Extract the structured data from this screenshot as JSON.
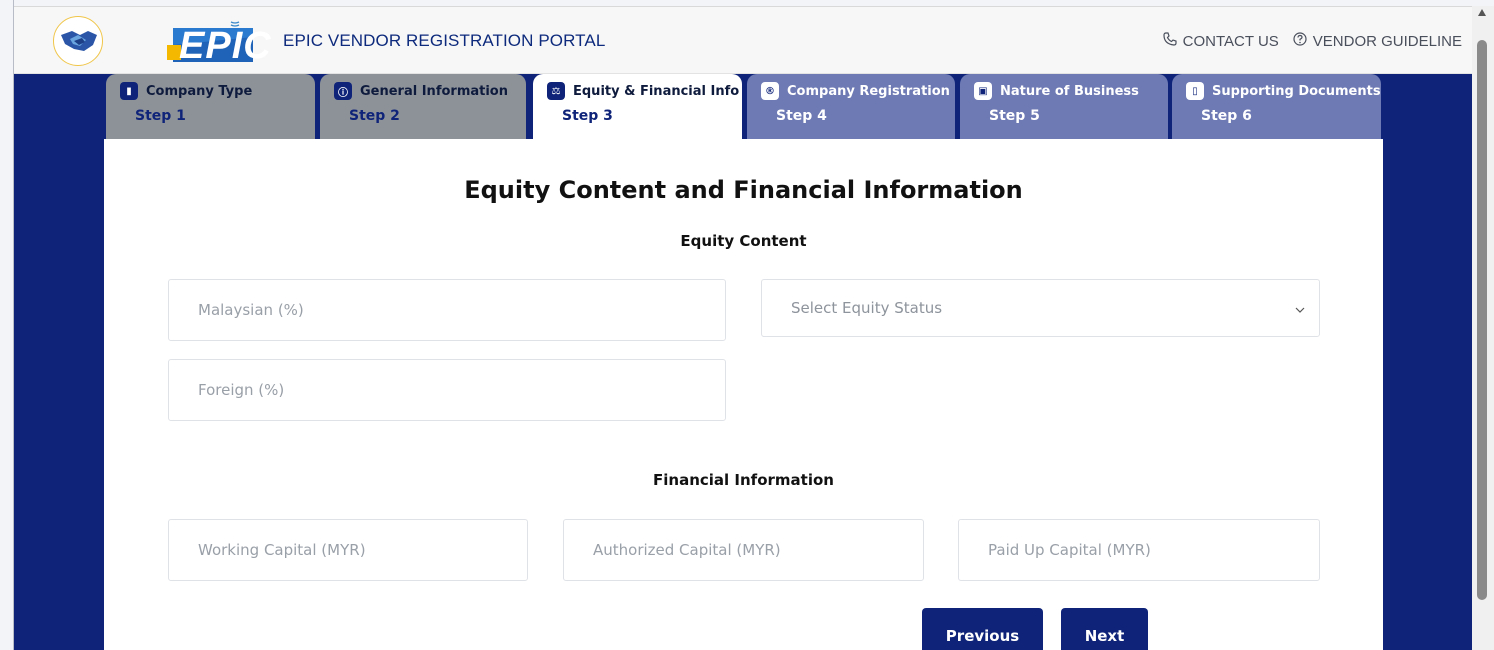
{
  "header": {
    "portal_title": "EPIC VENDOR REGISTRATION PORTAL",
    "logo_text": "EPIC",
    "contact_label": "CONTACT US",
    "guideline_label": "VENDOR GUIDELINE"
  },
  "steps": [
    {
      "label": "Company Type",
      "step": "Step 1",
      "state": "done",
      "icon": "building-icon"
    },
    {
      "label": "General Information",
      "step": "Step 2",
      "state": "done",
      "icon": "info-icon"
    },
    {
      "label": "Equity & Financial Info",
      "step": "Step 3",
      "state": "active",
      "icon": "scale-icon"
    },
    {
      "label": "Company Registration",
      "step": "Step 4",
      "state": "pending",
      "icon": "registered-icon"
    },
    {
      "label": "Nature of Business",
      "step": "Step 5",
      "state": "pending",
      "icon": "briefcase-icon"
    },
    {
      "label": "Supporting Documents",
      "step": "Step 6",
      "state": "pending",
      "icon": "document-icon"
    }
  ],
  "form": {
    "title": "Equity Content and Financial Information",
    "equity_heading": "Equity Content",
    "malaysian_placeholder": "Malaysian (%)",
    "foreign_placeholder": "Foreign (%)",
    "equity_status_selected": "Select Equity Status",
    "financial_heading": "Financial Information",
    "working_capital_placeholder": "Working Capital (MYR)",
    "authorized_capital_placeholder": "Authorized Capital (MYR)",
    "paid_up_capital_placeholder": "Paid Up Capital (MYR)"
  },
  "buttons": {
    "previous": "Previous",
    "next": "Next"
  },
  "colors": {
    "navy": "#0f2479",
    "tab_done": "#8d9299",
    "tab_pending": "#6e7ab4",
    "accent_yellow": "#f5b800"
  }
}
